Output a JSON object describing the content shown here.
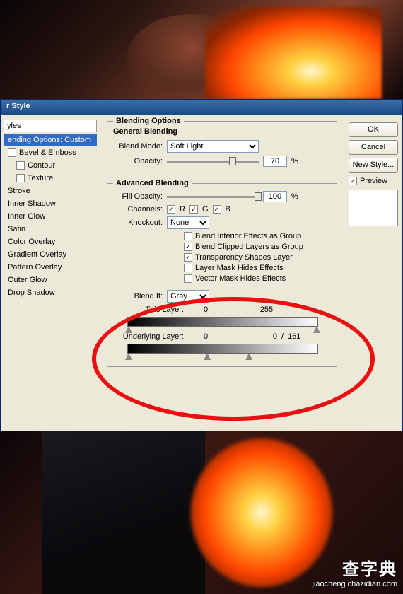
{
  "dialog": {
    "title": "r Style",
    "styles_header": "yles",
    "styles": [
      {
        "label": "ending Options: Custom",
        "selected": true,
        "checkbox": false
      },
      {
        "label": "Bevel & Emboss",
        "checkbox": true,
        "checked": false
      },
      {
        "label": "Contour",
        "checkbox": true,
        "checked": false,
        "indent": true
      },
      {
        "label": "Texture",
        "checkbox": true,
        "checked": false,
        "indent": true
      },
      {
        "label": "Stroke",
        "checkbox": false
      },
      {
        "label": "Inner Shadow",
        "checkbox": false
      },
      {
        "label": "Inner Glow",
        "checkbox": false
      },
      {
        "label": "Satin",
        "checkbox": false
      },
      {
        "label": "Color Overlay",
        "checkbox": false
      },
      {
        "label": "Gradient Overlay",
        "checkbox": false
      },
      {
        "label": "Pattern Overlay",
        "checkbox": false
      },
      {
        "label": "Outer Glow",
        "checkbox": false
      },
      {
        "label": "Drop Shadow",
        "checkbox": false
      }
    ]
  },
  "blending": {
    "section_title": "Blending Options",
    "general_title": "General Blending",
    "blend_mode_label": "Blend Mode:",
    "blend_mode_value": "Soft Light",
    "opacity_label": "Opacity:",
    "opacity_value": "70",
    "opacity_unit": "%",
    "advanced_title": "Advanced Blending",
    "fill_opacity_label": "Fill Opacity:",
    "fill_opacity_value": "100",
    "fill_opacity_unit": "%",
    "channels_label": "Channels:",
    "channel_r": "R",
    "channel_g": "G",
    "channel_b": "B",
    "knockout_label": "Knockout:",
    "knockout_value": "None",
    "adv_checks": [
      {
        "label": "Blend Interior Effects as Group",
        "checked": false
      },
      {
        "label": "Blend Clipped Layers as Group",
        "checked": true
      },
      {
        "label": "Transparency Shapes Layer",
        "checked": true
      },
      {
        "label": "Layer Mask Hides Effects",
        "checked": false
      },
      {
        "label": "Vector Mask Hides Effects",
        "checked": false
      }
    ],
    "blend_if_label": "Blend If:",
    "blend_if_value": "Gray",
    "this_layer_label": "This Layer:",
    "this_layer_low": "0",
    "this_layer_high": "255",
    "underlying_label": "Underlying Layer:",
    "underlying_low": "0",
    "underlying_split": "0",
    "underlying_sep": "/",
    "underlying_high": "161"
  },
  "buttons": {
    "ok": "OK",
    "cancel": "Cancel",
    "new_style": "New Style...",
    "preview": "Preview"
  },
  "watermark": {
    "site": "查字典",
    "url": "jiaocheng.chazidian.com"
  }
}
